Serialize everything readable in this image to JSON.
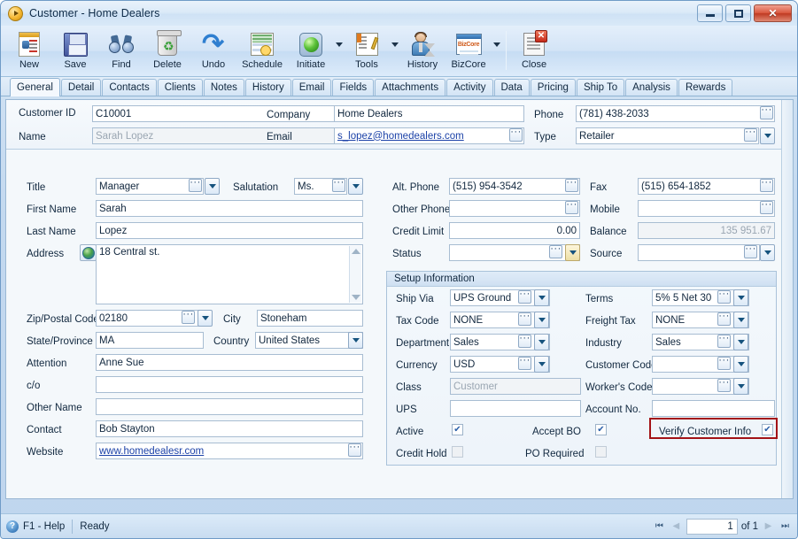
{
  "window": {
    "title": "Customer - Home Dealers",
    "minimize_label": "Minimize",
    "maximize_label": "Maximize",
    "close_label": "✕"
  },
  "toolbar": [
    {
      "label": "New",
      "icon": "new-document-icon",
      "has_arrow": false
    },
    {
      "label": "Save",
      "icon": "floppy-disk-icon",
      "has_arrow": false
    },
    {
      "label": "Find",
      "icon": "binoculars-icon",
      "has_arrow": false
    },
    {
      "label": "Delete",
      "icon": "recycle-bin-icon",
      "has_arrow": false
    },
    {
      "label": "Undo",
      "icon": "undo-arrow-icon",
      "has_arrow": false
    },
    {
      "label": "Schedule",
      "icon": "calendar-clock-icon",
      "has_arrow": false
    },
    {
      "label": "Initiate",
      "icon": "green-light-icon",
      "has_arrow": true
    },
    {
      "label": "Tools",
      "icon": "tools-wrench-icon",
      "has_arrow": true
    },
    {
      "label": "History",
      "icon": "person-hourglass-icon",
      "has_arrow": false
    },
    {
      "label": "BizCore",
      "icon": "bizcore-window-icon",
      "has_arrow": true
    },
    {
      "label": "Close",
      "icon": "close-document-icon",
      "has_arrow": false
    }
  ],
  "tabs": [
    {
      "label": "General",
      "active": true
    },
    {
      "label": "Detail",
      "active": false
    },
    {
      "label": "Contacts",
      "active": false
    },
    {
      "label": "Clients",
      "active": false
    },
    {
      "label": "Notes",
      "active": false
    },
    {
      "label": "History",
      "active": false
    },
    {
      "label": "Email",
      "active": false
    },
    {
      "label": "Fields",
      "active": false
    },
    {
      "label": "Attachments",
      "active": false
    },
    {
      "label": "Activity",
      "active": false
    },
    {
      "label": "Data",
      "active": false
    },
    {
      "label": "Pricing",
      "active": false
    },
    {
      "label": "Ship To",
      "active": false
    },
    {
      "label": "Analysis",
      "active": false
    },
    {
      "label": "Rewards",
      "active": false
    }
  ],
  "header": {
    "customer_id_label": "Customer ID",
    "customer_id_value": "C10001",
    "name_label": "Name",
    "name_value": "Sarah Lopez",
    "company_label": "Company",
    "company_value": "Home Dealers",
    "email_label": "Email",
    "email_value": "s_lopez@homedealers.com",
    "phone_label": "Phone",
    "phone_value": "(781) 438-2033",
    "type_label": "Type",
    "type_value": "Retailer"
  },
  "left": {
    "title_label": "Title",
    "title_value": "Manager",
    "salutation_label": "Salutation",
    "salutation_value": "Ms.",
    "first_name_label": "First Name",
    "first_name_value": "Sarah",
    "last_name_label": "Last Name",
    "last_name_value": "Lopez",
    "address_label": "Address",
    "address_value": "18 Central st.",
    "zip_label": "Zip/Postal Code",
    "zip_value": "02180",
    "city_label": "City",
    "city_value": "Stoneham",
    "state_label": "State/Province",
    "state_value": "MA",
    "country_label": "Country",
    "country_value": "United States",
    "attention_label": "Attention",
    "attention_value": "Anne Sue",
    "co_label": "c/o",
    "co_value": "",
    "other_name_label": "Other Name",
    "other_name_value": "",
    "contact_label": "Contact",
    "contact_value": "Bob Stayton",
    "website_label": "Website",
    "website_value": "www.homedealesr.com"
  },
  "right": {
    "alt_phone_label": "Alt. Phone",
    "alt_phone_value": "(515) 954-3542",
    "fax_label": "Fax",
    "fax_value": "(515) 654-1852",
    "other_phone_label": "Other Phone",
    "other_phone_value": "",
    "mobile_label": "Mobile",
    "mobile_value": "",
    "credit_limit_label": "Credit Limit",
    "credit_limit_value": "0.00",
    "balance_label": "Balance",
    "balance_value": "135 951.67",
    "status_label": "Status",
    "status_value": "",
    "source_label": "Source",
    "source_value": ""
  },
  "setup": {
    "title": "Setup Information",
    "ship_via_label": "Ship Via",
    "ship_via_value": "UPS Ground",
    "terms_label": "Terms",
    "terms_value": "5% 5 Net 30",
    "tax_code_label": "Tax Code",
    "tax_code_value": "NONE",
    "freight_tax_label": "Freight Tax",
    "freight_tax_value": "NONE",
    "department_label": "Department",
    "department_value": "Sales",
    "industry_label": "Industry",
    "industry_value": "Sales",
    "currency_label": "Currency",
    "currency_value": "USD",
    "customer_code_label": "Customer Code",
    "customer_code_value": "",
    "class_label": "Class",
    "class_value": "Customer",
    "workers_code_label": "Worker's Code",
    "workers_code_value": "",
    "ups_label": "UPS",
    "ups_value": "",
    "account_no_label": "Account No.",
    "account_no_value": "",
    "active_label": "Active",
    "active_checked": true,
    "accept_bo_label": "Accept BO",
    "accept_bo_checked": true,
    "verify_customer_info_label": "Verify Customer Info",
    "verify_customer_info_checked": true,
    "credit_hold_label": "Credit Hold",
    "credit_hold_checked": false,
    "po_required_label": "PO Required",
    "po_required_checked": false
  },
  "statusbar": {
    "help_label": "F1 - Help",
    "state": "Ready",
    "page_value": "1",
    "of_label": "of 1",
    "first_icon": "first-record-icon",
    "prev_icon": "previous-record-icon",
    "next_icon": "next-record-icon",
    "last_icon": "last-record-icon"
  },
  "colors": {
    "highlight_box": "#a31317",
    "accent_blue": "#2a5fa8",
    "link": "#1c42a8"
  }
}
